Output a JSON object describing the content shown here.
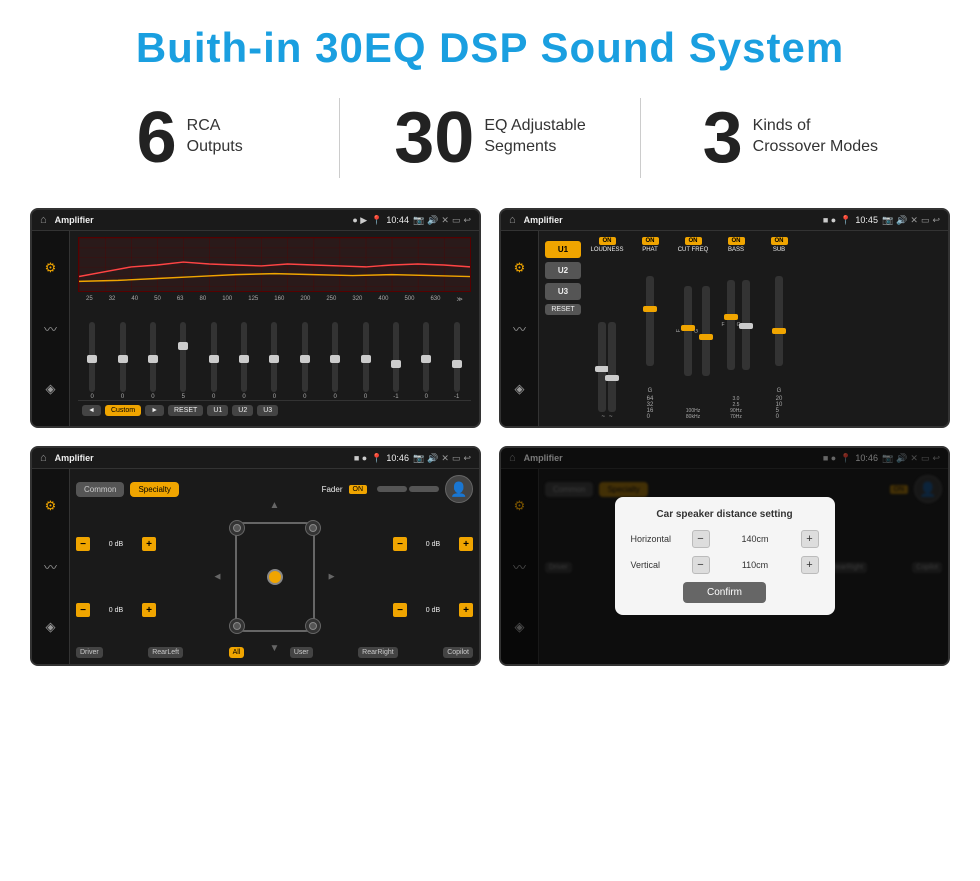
{
  "header": {
    "title": "Buith-in 30EQ DSP Sound System"
  },
  "stats": [
    {
      "number": "6",
      "label": "RCA\nOutputs"
    },
    {
      "number": "30",
      "label": "EQ Adjustable\nSegments"
    },
    {
      "number": "3",
      "label": "Kinds of\nCrossover Modes"
    }
  ],
  "screens": {
    "eq": {
      "title": "Amplifier",
      "time": "10:44",
      "frequencies": [
        "25",
        "32",
        "40",
        "50",
        "63",
        "80",
        "100",
        "125",
        "160",
        "200",
        "250",
        "320",
        "400",
        "500",
        "630"
      ],
      "values": [
        "0",
        "0",
        "0",
        "5",
        "0",
        "0",
        "0",
        "0",
        "0",
        "0",
        "-1",
        "0",
        "-1"
      ],
      "bottomButtons": [
        "◄",
        "Custom",
        "►",
        "RESET",
        "U1",
        "U2",
        "U3"
      ]
    },
    "crossover": {
      "title": "Amplifier",
      "time": "10:45",
      "uButtons": [
        "U1",
        "U2",
        "U3"
      ],
      "columns": [
        "LOUDNESS",
        "PHAT",
        "CUT FREQ",
        "BASS",
        "SUB"
      ],
      "resetLabel": "RESET"
    },
    "fader": {
      "title": "Amplifier",
      "time": "10:46",
      "tabs": [
        "Common",
        "Specialty"
      ],
      "faderLabel": "Fader",
      "onLabel": "ON",
      "bottomLabels": [
        "Driver",
        "RearLeft",
        "All",
        "User",
        "RearRight",
        "Copilot"
      ],
      "dbValues": [
        "0 dB",
        "0 dB",
        "0 dB",
        "0 dB"
      ]
    },
    "dialog": {
      "title": "Amplifier",
      "time": "10:46",
      "tabs": [
        "Common",
        "Specialty"
      ],
      "dialogTitle": "Car speaker distance setting",
      "horizontal": {
        "label": "Horizontal",
        "value": "140cm"
      },
      "vertical": {
        "label": "Vertical",
        "value": "110cm"
      },
      "confirmLabel": "Confirm",
      "bottomLabels": [
        "Driver",
        "RearLeft.",
        "All",
        "User",
        "RearRight",
        "Copilot"
      ]
    }
  }
}
